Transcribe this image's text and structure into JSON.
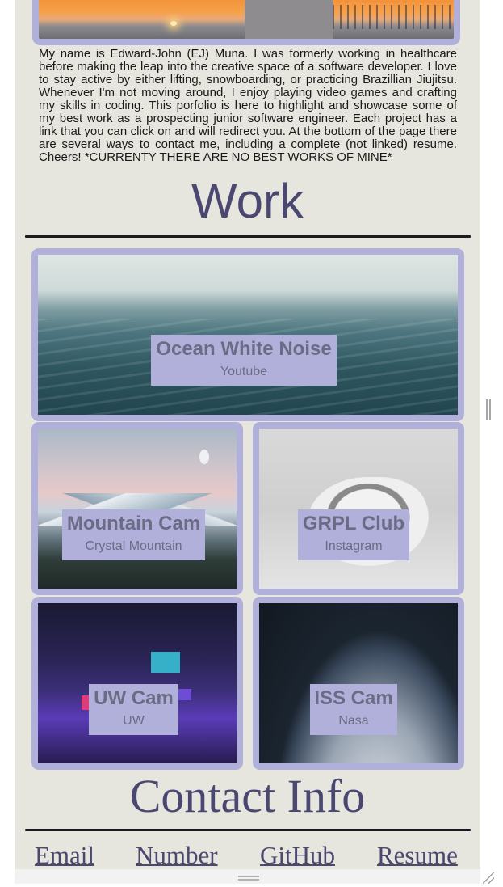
{
  "about": {
    "bio": "My name is Edward-John (EJ) Muna. I was formerly working in healthcare before making the leap into the creative space of a software developer. I love to stay active by either lifting, snowboarding, or practicing Brazillian Jiujitsu. Whenever I'm not moving around, I enjoy playing video games and crafting my skills in coding. This porfolio is here to highlight and showcase some of my best work as a prospecting junior software engineer. Each project has a link that you can click on and will redirect you. At the bottom of the page there are several ways to contact me, including a complete (not linked) resume. Cheers! *CURRENTY THERE ARE NO BEST WORKS OF MINE*"
  },
  "work": {
    "title": "Work",
    "cards": [
      {
        "title": "Ocean White Noise",
        "subtitle": "Youtube"
      },
      {
        "title": "Mountain Cam",
        "subtitle": "Crystal Mountain"
      },
      {
        "title": "GRPL Club",
        "subtitle": "Instagram"
      },
      {
        "title": "UW Cam",
        "subtitle": "UW"
      },
      {
        "title": "ISS Cam",
        "subtitle": "Nasa"
      }
    ]
  },
  "contact": {
    "title": "Contact Info",
    "links": [
      "Email",
      "Number",
      "GitHub",
      "Resume"
    ]
  },
  "theme": {
    "page_bg": "#e6e5de",
    "accent": "#b1b0da",
    "heading_color": "#4a4870"
  }
}
